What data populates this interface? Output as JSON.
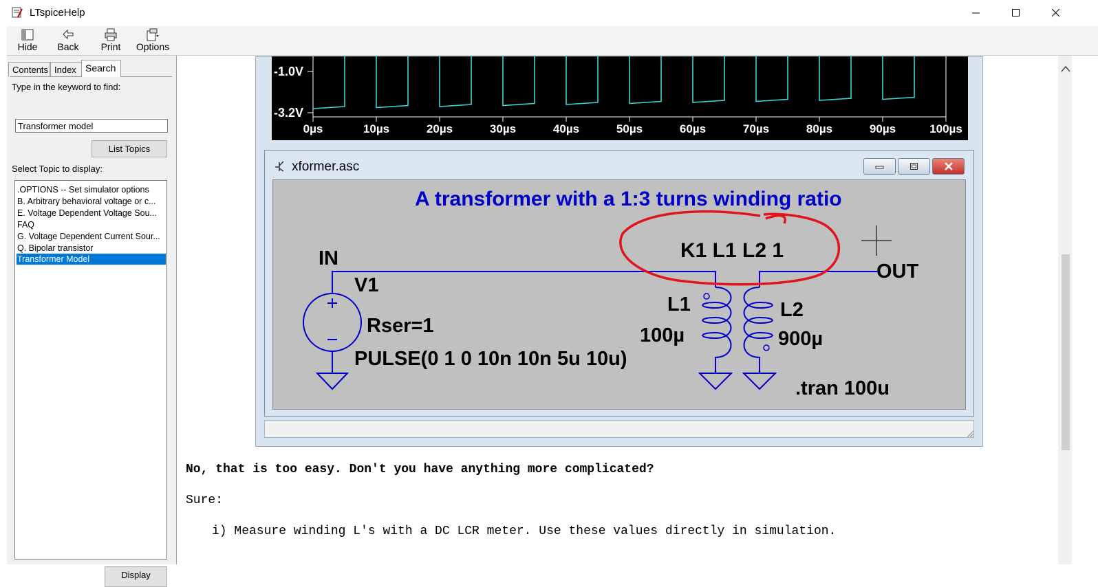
{
  "window": {
    "title": "LTspiceHelp"
  },
  "toolbar": {
    "hide": "Hide",
    "back": "Back",
    "print": "Print",
    "options": "Options"
  },
  "nav": {
    "tabs": [
      "Contents",
      "Index",
      "Search"
    ],
    "prompt": "Type in the keyword to find:",
    "keyword": "Transformer model",
    "list_topics": "List Topics",
    "select_label": "Select Topic to display:",
    "topics": [
      ".OPTIONS -- Set simulator options",
      "B.  Arbitrary behavioral voltage or c...",
      "E. Voltage Dependent Voltage Sou...",
      "FAQ",
      "G. Voltage Dependent Current Sour...",
      "Q. Bipolar transistor",
      "Transformer Model"
    ],
    "display": "Display"
  },
  "plot": {
    "y_ticks": [
      "-1.0V",
      "-3.2V"
    ],
    "x_ticks": [
      "0µs",
      "10µs",
      "20µs",
      "30µs",
      "40µs",
      "50µs",
      "60µs",
      "70µs",
      "80µs",
      "90µs",
      "100µs"
    ],
    "trace_color": "#3fd4d4"
  },
  "schematic": {
    "window_title": "xformer.asc",
    "heading": "A transformer with a 1:3 turns winding ratio",
    "coupling": "K1 L1 L2 1",
    "net_in": "IN",
    "net_out": "OUT",
    "source_name": "V1",
    "source_rser": "Rser=1",
    "source_value": "PULSE(0 1 0 10n 10n 5u 10u)",
    "l1_name": "L1",
    "l1_value": "100µ",
    "l2_name": "L2",
    "l2_value": "900µ",
    "directive": ".tran 100u",
    "wire_color": "#0000c8",
    "heading_color": "#0000c8",
    "annotation_color": "#e0141e"
  },
  "text": {
    "q": "No, that is too easy. Don't you have anything more complicated?",
    "a": "Sure:",
    "item1": "i) Measure winding L's with a DC LCR meter. Use these values directly in simulation."
  }
}
